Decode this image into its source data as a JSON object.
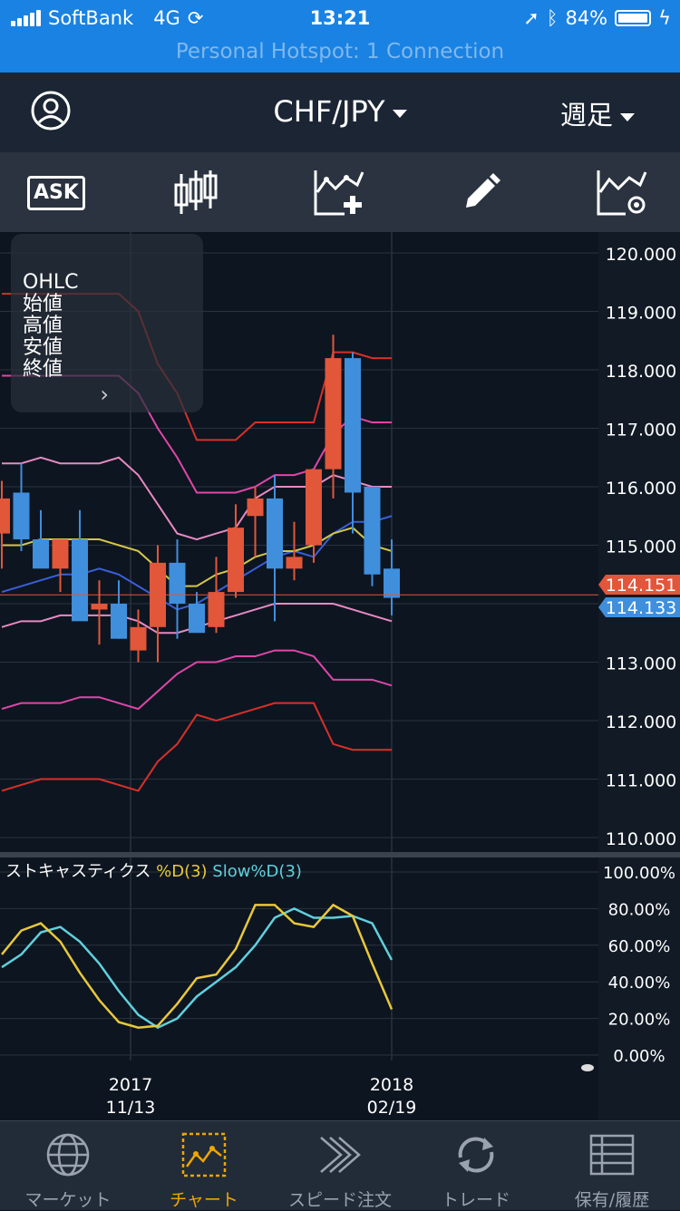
{
  "status_bar": {
    "carrier": "SoftBank",
    "network": "4G",
    "time": "13:21",
    "battery": "84%",
    "hotspot": "Personal Hotspot: 1 Connection"
  },
  "header": {
    "pair": "CHF/JPY",
    "period": "週足"
  },
  "toolbar": {
    "ask_label": "ASK"
  },
  "ohlc_panel": {
    "title": "OHLC",
    "open": "始値",
    "high": "高値",
    "low": "安値",
    "close": "終値",
    "more": "›"
  },
  "chart_data": {
    "type": "candlestick",
    "price_axis": [
      "120.000",
      "119.000",
      "118.000",
      "117.000",
      "116.000",
      "115.000",
      "114.000",
      "113.000",
      "112.000",
      "111.000",
      "110.000"
    ],
    "price_labels": {
      "ask": "114.151",
      "bid": "114.133"
    },
    "x_labels": [
      {
        "year": "2017",
        "date": "11/13"
      },
      {
        "year": "2018",
        "date": "02/19"
      }
    ],
    "candles": [
      {
        "o": 115.2,
        "h": 116.1,
        "l": 114.6,
        "c": 115.8
      },
      {
        "o": 115.9,
        "h": 116.4,
        "l": 114.9,
        "c": 115.1
      },
      {
        "o": 115.1,
        "h": 115.6,
        "l": 114.7,
        "c": 114.6
      },
      {
        "o": 114.6,
        "h": 115.1,
        "l": 114.2,
        "c": 115.1
      },
      {
        "o": 115.1,
        "h": 115.6,
        "l": 113.8,
        "c": 113.7
      },
      {
        "o": 113.9,
        "h": 114.4,
        "l": 113.3,
        "c": 114.0
      },
      {
        "o": 114.0,
        "h": 114.4,
        "l": 113.4,
        "c": 113.4
      },
      {
        "o": 113.2,
        "h": 113.9,
        "l": 113.0,
        "c": 113.6
      },
      {
        "o": 113.6,
        "h": 115.0,
        "l": 113.0,
        "c": 114.7
      },
      {
        "o": 114.7,
        "h": 115.1,
        "l": 113.4,
        "c": 114.0
      },
      {
        "o": 114.0,
        "h": 114.2,
        "l": 113.6,
        "c": 113.5
      },
      {
        "o": 113.6,
        "h": 114.8,
        "l": 113.5,
        "c": 114.2
      },
      {
        "o": 114.2,
        "h": 115.7,
        "l": 114.1,
        "c": 115.3
      },
      {
        "o": 115.5,
        "h": 116.0,
        "l": 114.8,
        "c": 115.8
      },
      {
        "o": 115.8,
        "h": 116.2,
        "l": 113.7,
        "c": 114.6
      },
      {
        "o": 114.6,
        "h": 115.4,
        "l": 114.4,
        "c": 114.8
      },
      {
        "o": 115.0,
        "h": 116.2,
        "l": 114.7,
        "c": 116.3
      },
      {
        "o": 116.3,
        "h": 118.6,
        "l": 115.8,
        "c": 118.2
      },
      {
        "o": 118.2,
        "h": 118.3,
        "l": 115.2,
        "c": 115.9
      },
      {
        "o": 116.0,
        "h": 116.0,
        "l": 114.3,
        "c": 114.5
      },
      {
        "o": 114.6,
        "h": 115.1,
        "l": 113.8,
        "c": 114.1
      }
    ],
    "bands": {
      "upper3": [
        119.3,
        119.3,
        119.3,
        119.3,
        119.3,
        119.3,
        119.3,
        119.0,
        118.1,
        117.6,
        116.8,
        116.8,
        116.8,
        117.1,
        117.1,
        117.1,
        117.1,
        118.3,
        118.3,
        118.2,
        118.2
      ],
      "upper2": [
        117.9,
        117.9,
        117.9,
        117.9,
        117.9,
        117.9,
        117.9,
        117.6,
        117.0,
        116.5,
        115.9,
        115.9,
        115.9,
        116.0,
        116.2,
        116.2,
        116.3,
        116.9,
        117.2,
        117.1,
        117.1
      ],
      "upper1": [
        116.4,
        116.4,
        116.5,
        116.4,
        116.4,
        116.4,
        116.5,
        116.2,
        115.7,
        115.2,
        115.1,
        115.2,
        115.3,
        115.8,
        116.0,
        116.0,
        116.0,
        116.2,
        116.1,
        116.0,
        116.0
      ],
      "middle": [
        114.2,
        114.3,
        114.4,
        114.5,
        114.5,
        114.6,
        114.5,
        114.3,
        114.1,
        113.9,
        114.0,
        114.2,
        114.4,
        114.6,
        114.8,
        114.9,
        114.8,
        115.2,
        115.4,
        115.4,
        115.5
      ],
      "mid_alt": [
        115.0,
        115.0,
        115.1,
        115.1,
        115.1,
        115.1,
        115.0,
        114.9,
        114.6,
        114.3,
        114.3,
        114.5,
        114.6,
        114.8,
        114.9,
        114.9,
        115.0,
        115.2,
        115.3,
        115.0,
        114.9
      ],
      "lower1": [
        113.6,
        113.7,
        113.7,
        113.8,
        113.8,
        113.8,
        113.8,
        113.7,
        113.5,
        113.5,
        113.6,
        113.7,
        113.8,
        113.9,
        114.0,
        114.0,
        114.0,
        114.0,
        113.9,
        113.8,
        113.7
      ],
      "lower2": [
        112.2,
        112.3,
        112.3,
        112.3,
        112.4,
        112.4,
        112.3,
        112.2,
        112.5,
        112.8,
        113.0,
        113.0,
        113.1,
        113.1,
        113.2,
        113.2,
        113.1,
        112.7,
        112.7,
        112.7,
        112.6
      ],
      "lower3": [
        110.8,
        110.9,
        111.0,
        111.0,
        111.0,
        111.0,
        110.9,
        110.8,
        111.3,
        111.6,
        112.1,
        112.0,
        112.1,
        112.2,
        112.3,
        112.3,
        112.3,
        111.6,
        111.5,
        111.5,
        111.5
      ]
    },
    "stochastic": {
      "label": "ストキャスティクス",
      "d_label": "%D(3)",
      "slow_label": "Slow%D(3)",
      "axis": [
        "100.00%",
        "80.00%",
        "60.00%",
        "40.00%",
        "20.00%",
        "0.00%"
      ],
      "d": [
        55,
        68,
        72,
        62,
        45,
        30,
        18,
        15,
        16,
        28,
        42,
        44,
        58,
        82,
        82,
        72,
        70,
        82,
        76,
        50,
        25
      ],
      "slow": [
        48,
        55,
        67,
        70,
        62,
        50,
        35,
        22,
        15,
        20,
        32,
        40,
        48,
        60,
        75,
        80,
        75,
        75,
        76,
        72,
        52
      ]
    },
    "colors": {
      "up": "#e2563a",
      "down": "#3f8fdc",
      "band_outer": "#d8302a",
      "band_mid": "#e046a8",
      "band_inner": "#e68ac2",
      "middle": "#3a5fd8",
      "mid_alt": "#d4c64a",
      "d": "#e8c83a",
      "slow": "#5fd0dc",
      "ask_bg": "#e2563a",
      "bid_bg": "#3f8fdc"
    }
  },
  "tabs": [
    {
      "label": "マーケット",
      "icon": "globe-icon",
      "active": false
    },
    {
      "label": "チャート",
      "icon": "chart-icon",
      "active": true
    },
    {
      "label": "スピード注文",
      "icon": "speed-arrows-icon",
      "active": false
    },
    {
      "label": "トレード",
      "icon": "refresh-arrows-icon",
      "active": false
    },
    {
      "label": "保有/履歴",
      "icon": "list-icon",
      "active": false
    }
  ]
}
